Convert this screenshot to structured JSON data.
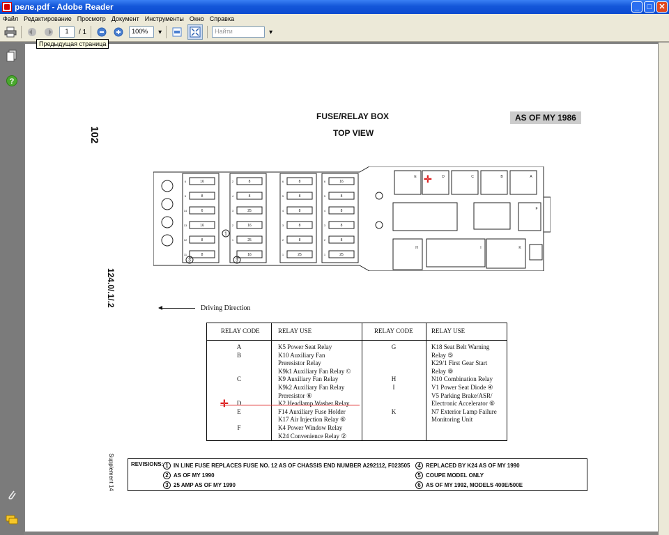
{
  "window": {
    "title": "реле.pdf - Adobe Reader",
    "buttons": {
      "minimize": "_",
      "maximize": "□",
      "close": "✕"
    }
  },
  "menu": [
    "Файл",
    "Редактирование",
    "Просмотр",
    "Документ",
    "Инструменты",
    "Окно",
    "Справка"
  ],
  "toolbar": {
    "page_current": "1",
    "page_total": "/ 1",
    "zoom": "100%",
    "search_placeholder": "Найти",
    "tooltip": "Предыдущая страница"
  },
  "doc": {
    "page_number": "102",
    "title_line1": "FUSE/RELAY BOX",
    "title_line2": "TOP VIEW",
    "as_of": "AS OF MY 1986",
    "model": "124.0/.1/.2",
    "driving_direction": "Driving Direction",
    "supplement": "Supplement 14",
    "table": {
      "headers": [
        "RELAY CODE",
        "RELAY USE",
        "RELAY CODE",
        "RELAY USE"
      ],
      "left_codes": [
        {
          "code": "A",
          "row": 0
        },
        {
          "code": "B",
          "row": 1
        },
        {
          "code": "C",
          "row": 4
        },
        {
          "code": "D",
          "row": 7
        },
        {
          "code": "E",
          "row": 8
        },
        {
          "code": "F",
          "row": 10
        }
      ],
      "left_uses": [
        "K5 Power Seat Relay",
        "K10 Auxiliary Fan",
        "Preresistor Relay",
        "K9k1 Auxiliary Fan Relay ©",
        "K9 Auxiliary Fan Relay",
        "K9k2 Auxiliary Fan Relay",
        "Preresistor ⑥",
        "K2 Headlamp Washer Relay",
        "F14 Auxiliary Fuse Holder",
        "K17 Air Injection Relay ⑥",
        "K4 Power Window Relay",
        "K24 Convenience Relay ②"
      ],
      "right_codes": [
        {
          "code": "G",
          "row": 0
        },
        {
          "code": "H",
          "row": 4
        },
        {
          "code": "I",
          "row": 5
        },
        {
          "code": "K",
          "row": 8
        }
      ],
      "right_uses": [
        "K18 Seat Belt Warning",
        "Relay ⑤",
        "K29/1 First Gear Start",
        "Relay ⑧",
        "N10 Combination Relay",
        "V1 Power Seat Diode ④",
        "V5 Parking Brake/ASR/",
        "Electronic Accelerator ⑥",
        "N7 Exterior Lamp Failure",
        "Monitoring Unit"
      ]
    },
    "revisions": {
      "label": "REVISIONS:",
      "items": [
        {
          "n": "1",
          "text": "IN LINE FUSE REPLACES FUSE NO. 12 AS OF CHASSIS END NUMBER A292112, F023505"
        },
        {
          "n": "2",
          "text": "AS OF MY 1990"
        },
        {
          "n": "3",
          "text": "25 AMP AS OF MY 1990"
        },
        {
          "n": "4",
          "text": "REPLACED BY K24 AS OF MY 1990"
        },
        {
          "n": "5",
          "text": "COUPE MODEL ONLY"
        },
        {
          "n": "6",
          "text": "AS OF MY 1992, MODELS 400E/500E"
        }
      ]
    },
    "fuse_labels": {
      "col1_left": [
        "6",
        "5",
        "14",
        "13",
        "12",
        "11"
      ],
      "col1": [
        "16",
        "8",
        "6",
        "16",
        "8",
        "8"
      ],
      "col2_left": [
        "2",
        "4",
        "3",
        "2",
        "1",
        ""
      ],
      "col2": [
        "8",
        "8",
        "25",
        "16",
        "25",
        "16"
      ],
      "col3_left": [
        "6",
        "5",
        "4",
        "3",
        "2",
        "1"
      ],
      "col3": [
        "8",
        "8",
        "8",
        "8",
        "8",
        "25"
      ],
      "col4_left": [
        "6",
        "5",
        "4",
        "3",
        "2",
        "1"
      ],
      "col4": [
        "16",
        "8",
        "8",
        "8",
        "8",
        "25"
      ],
      "circle_labels": [
        "3",
        "3",
        "1"
      ]
    },
    "relay_labels": [
      "E",
      "D",
      "C",
      "B",
      "A",
      "F",
      "H",
      "I",
      "K"
    ]
  }
}
